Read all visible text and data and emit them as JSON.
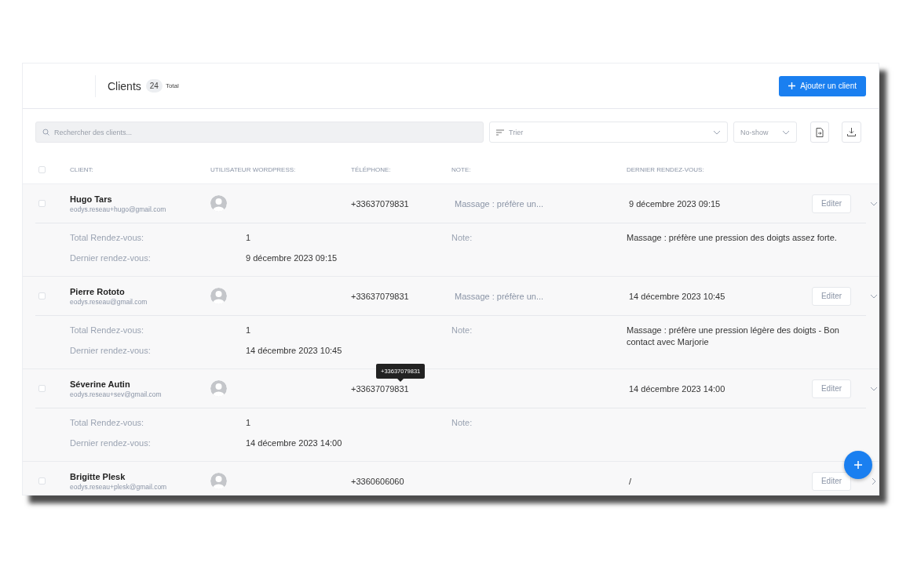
{
  "header": {
    "title": "Clients",
    "count": "24",
    "count_label": "Total",
    "add_button": "Ajouter un client"
  },
  "toolbar": {
    "search": {
      "placeholder": "Rechercher des clients..."
    },
    "sort": {
      "placeholder": "Trier"
    },
    "no_show": {
      "placeholder": "No-show"
    }
  },
  "table": {
    "select_all": {
      "checked": false
    },
    "columns": [
      "CLIENT:",
      "UTILISATEUR WORDPRESS:",
      "TÉLÉPHONE:",
      "NOTE:",
      "DERNIER RENDEZ-VOUS:"
    ],
    "rows": [
      {
        "checked": false,
        "name": "Hugo Tars",
        "email": "eodys.reseau+hugo@gmail.com",
        "phone": "+33637079831",
        "note_preview": "Massage : préfère un...",
        "last_appointment": "9 décembre 2023 09:15",
        "edit": "Editer",
        "expanded": true,
        "details": {
          "total_label": "Total Rendez-vous:",
          "total": "1",
          "last_label": "Dernier rendez-vous:",
          "last": "9 décembre 2023 09:15",
          "note_label": "Note:",
          "note": "Massage : préfère une pression des doigts assez forte."
        }
      },
      {
        "checked": false,
        "name": "Pierre Rototo",
        "email": "eodys.reseau@gmail.com",
        "phone": "+33637079831",
        "note_preview": "Massage : préfère un...",
        "last_appointment": "14 décembre 2023 10:45",
        "edit": "Editer",
        "expanded": true,
        "details": {
          "total_label": "Total Rendez-vous:",
          "total": "1",
          "last_label": "Dernier rendez-vous:",
          "last": "14 décembre 2023 10:45",
          "note_label": "Note:",
          "note": "Massage : préfère une pression légère des doigts - Bon contact avec Marjorie"
        }
      },
      {
        "checked": false,
        "name": "Séverine Autin",
        "email": "eodys.reseau+sev@gmail.com",
        "phone": "+33637079831",
        "phone_tooltip": "+33637079831",
        "last_appointment": "14 décembre 2023 14:00",
        "edit": "Editer",
        "expanded": true,
        "details": {
          "total_label": "Total Rendez-vous:",
          "total": "1",
          "last_label": "Dernier rendez-vous:",
          "last": "14 décembre 2023 14:00",
          "note_label": "Note:"
        }
      },
      {
        "checked": false,
        "name": "Brigitte Plesk",
        "email": "eodys.reseau+plesk@gmail.com",
        "phone": "+3360606060",
        "last_appointment": "/",
        "edit": "Editer",
        "expanded": false
      }
    ]
  }
}
